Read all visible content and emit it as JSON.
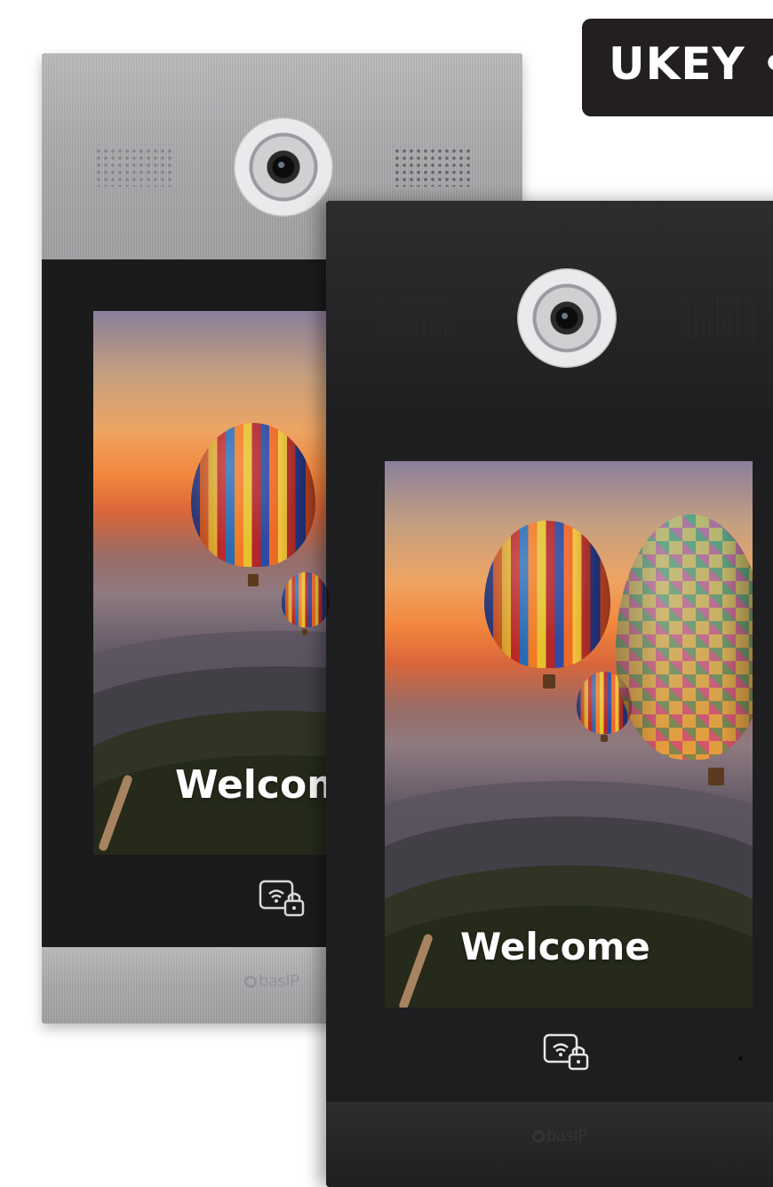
{
  "badge": {
    "text": "UKEY •"
  },
  "back_panel": {
    "finish": "silver",
    "welcome": "Welcome",
    "brand": "basIP"
  },
  "front_panel": {
    "finish": "black",
    "welcome": "Welcome",
    "brand": "basIP"
  },
  "icons": {
    "camera": "camera-lens-icon",
    "nfc": "nfc-ukey-lock-icon",
    "speaker": "speaker-grille-icon",
    "logo": "basip-logo-icon"
  },
  "colors": {
    "badge_bg": "#231f20",
    "silver_cap": "#a9aaac",
    "panel_black": "#1e1e20",
    "sunset_orange": "#f3873d"
  }
}
